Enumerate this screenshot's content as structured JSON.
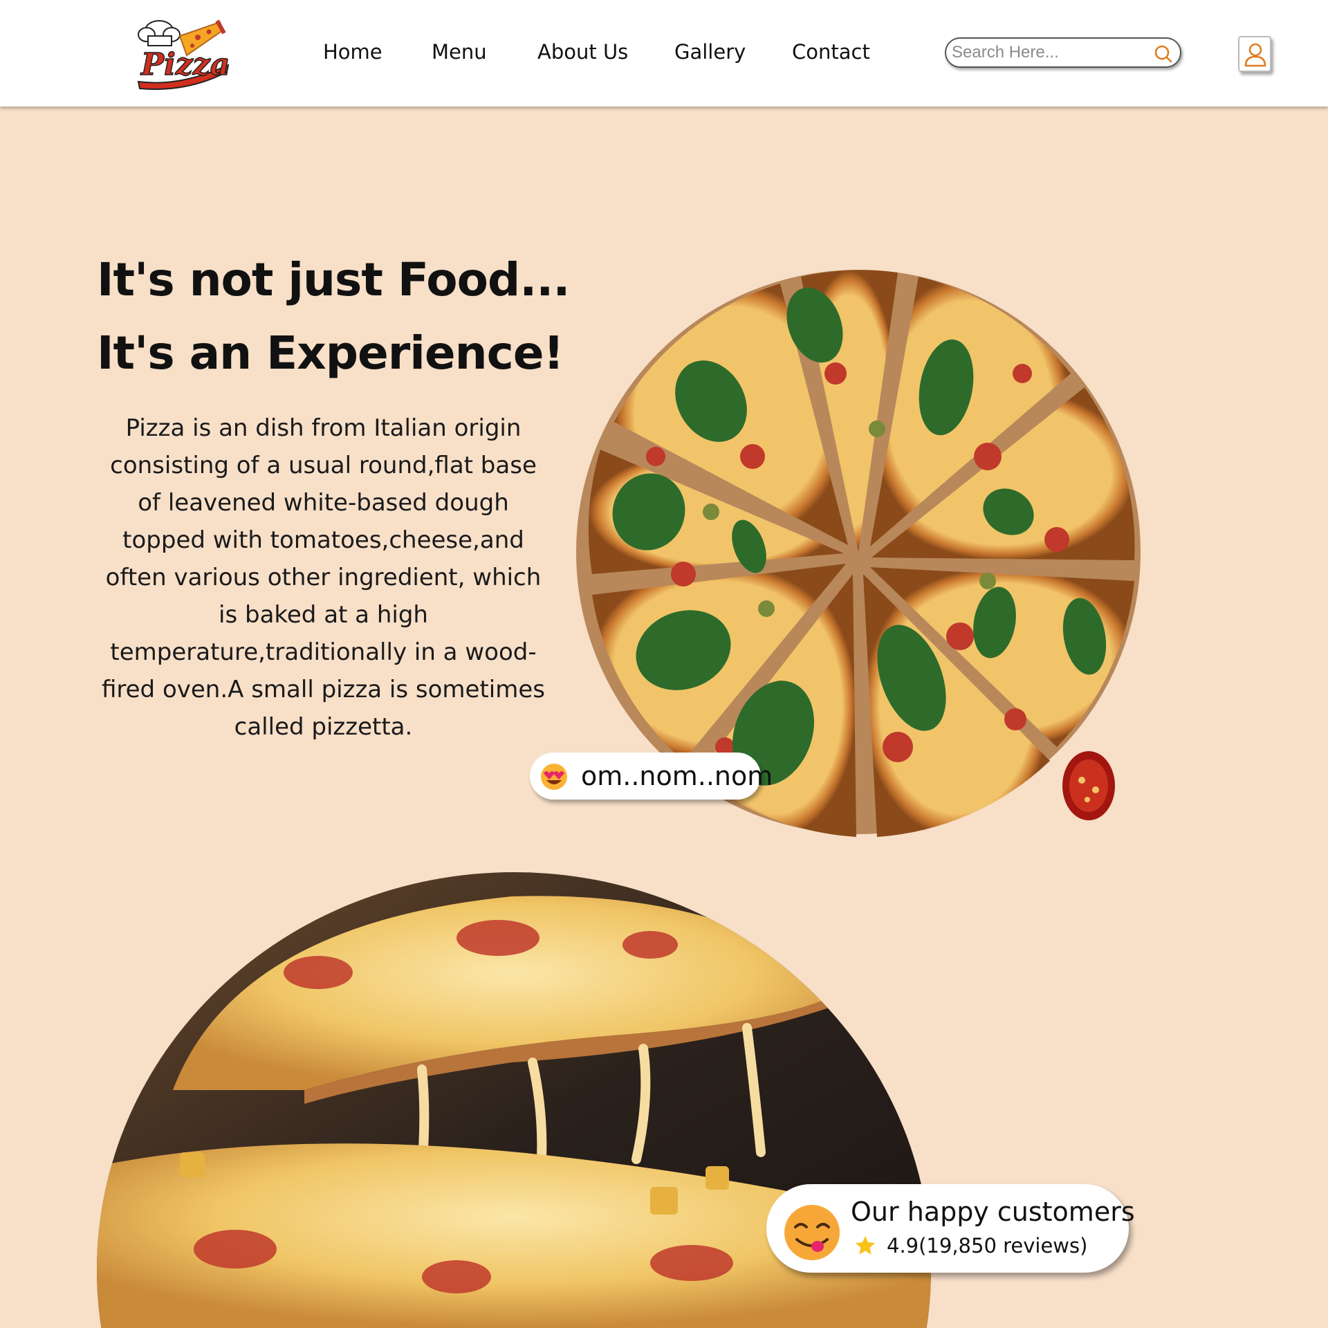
{
  "header": {
    "logo_text": "Pizza",
    "nav": [
      "Home",
      "Menu",
      "About Us",
      "Gallery",
      "Contact"
    ],
    "search_placeholder": "Search Here...",
    "icons": {
      "search": "search-icon",
      "user": "user-icon"
    }
  },
  "hero": {
    "title_line1": "It's not just Food...",
    "title_line2": "It's an Experience!",
    "description": "Pizza is an dish from Italian origin consisting of a usual round,flat base of leavened white-based dough topped with tomatoes,cheese,and often various other ingredient, which is baked at a high temperature,traditionally in a wood-fired oven.A small pizza is sometimes called pizzetta."
  },
  "badges": {
    "nom_emoji": "heart-eyes-emoji",
    "nom_text": "om..nom..nom",
    "customers_emoji": "yum-face-emoji",
    "customers_title": "Our happy customers",
    "customers_rating": "4.9(19,850 reviews)"
  },
  "colors": {
    "background": "#f7dfc8",
    "header": "#ffffff",
    "accent_orange": "#e07a1f",
    "logo_red": "#d32f1e"
  }
}
